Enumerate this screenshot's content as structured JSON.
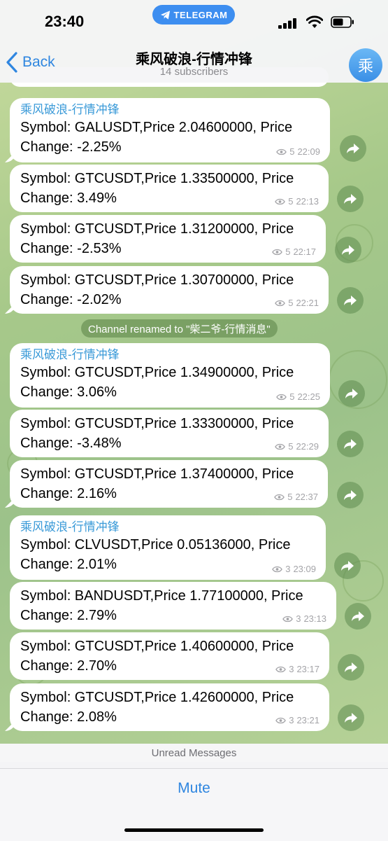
{
  "status_bar": {
    "time": "23:40",
    "pill_label": "TELEGRAM"
  },
  "header": {
    "back_label": "Back",
    "title": "乘风破浪-行情冲锋",
    "subtitle": "14 subscribers",
    "avatar_letter": "乘"
  },
  "colors": {
    "accent": "#2f86e0",
    "sender": "#3a9ad8",
    "telegram_pill": "#3d8ef0"
  },
  "messages": [
    {
      "sender": "乘风破浪-行情冲锋",
      "text": "Symbol: GALUSDT,Price 2.04600000, Price\nChange: -2.25%",
      "views": "5",
      "time": "22:09"
    },
    {
      "sender": "",
      "text": "Symbol: GTCUSDT,Price 1.33500000, Price\nChange: 3.49%",
      "views": "5",
      "time": "22:13"
    },
    {
      "sender": "",
      "text": "Symbol: GTCUSDT,Price 1.31200000, Price\nChange: -2.53%",
      "views": "5",
      "time": "22:17"
    },
    {
      "sender": "",
      "text": "Symbol: GTCUSDT,Price 1.30700000, Price\nChange: -2.02%",
      "views": "5",
      "time": "22:21"
    },
    {
      "sender": "乘风破浪-行情冲锋",
      "text": "Symbol: GTCUSDT,Price 1.34900000, Price\nChange: 3.06%",
      "views": "5",
      "time": "22:25"
    },
    {
      "sender": "",
      "text": "Symbol: GTCUSDT,Price 1.33300000, Price\nChange: -3.48%",
      "views": "5",
      "time": "22:29"
    },
    {
      "sender": "",
      "text": "Symbol: GTCUSDT,Price 1.37400000, Price\nChange: 2.16%",
      "views": "5",
      "time": "22:37"
    },
    {
      "sender": "乘风破浪-行情冲锋",
      "text": "Symbol: CLVUSDT,Price 0.05136000, Price\nChange: 2.01%",
      "views": "3",
      "time": "23:09"
    },
    {
      "sender": "",
      "text": "Symbol: BANDUSDT,Price 1.77100000, Price\nChange: 2.79%",
      "views": "3",
      "time": "23:13"
    },
    {
      "sender": "",
      "text": "Symbol: GTCUSDT,Price 1.40600000, Price\nChange: 2.70%",
      "views": "3",
      "time": "23:17"
    },
    {
      "sender": "",
      "text": "Symbol: GTCUSDT,Price 1.42600000, Price\nChange: 2.08%",
      "views": "3",
      "time": "23:21"
    }
  ],
  "service_message": "Channel renamed to \"柴二爷-行情消息\"",
  "unread_label": "Unread Messages",
  "mute_label": "Mute"
}
